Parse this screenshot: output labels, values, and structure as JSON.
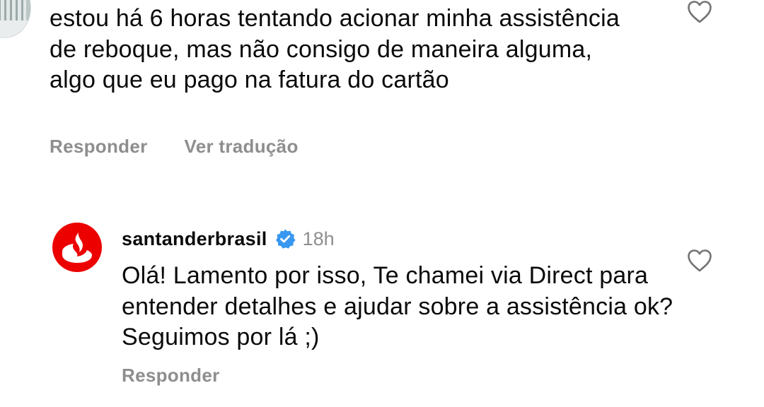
{
  "comment": {
    "text": "estou há 6 horas tentando acionar minha assistência de reboque, mas não consigo de maneira alguma, algo que eu pago na fatura do cartão",
    "reply_label": "Responder",
    "translate_label": "Ver tradução",
    "like_icon": "heart-outline-icon"
  },
  "reply": {
    "username": "santanderbrasil",
    "verified_icon": "verified-badge-icon",
    "time": "18h",
    "text": "Olá! Lamento por isso, Te chamei via Direct para entender detalhes e ajudar sobre a assistência ok? Seguimos por lá ;)",
    "reply_label": "Responder",
    "like_icon": "heart-outline-icon",
    "avatar_icon": "santander-flame-logo"
  },
  "colors": {
    "text": "#0a0a0a",
    "secondary": "#8e8e8e",
    "santander_red": "#ec0000",
    "verified_blue": "#3897f0"
  }
}
